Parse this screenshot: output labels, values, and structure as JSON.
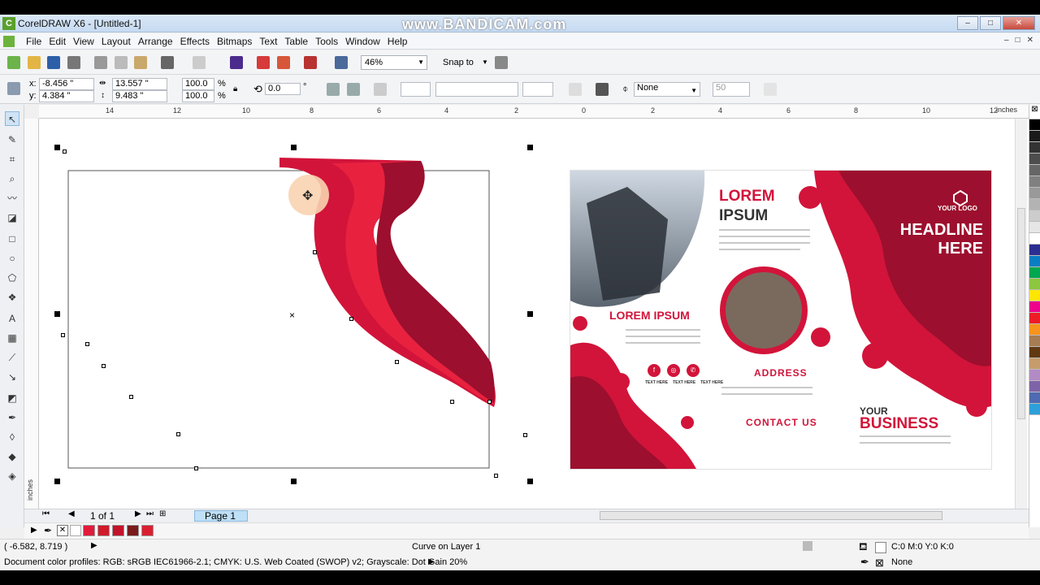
{
  "window": {
    "title": "CorelDRAW X6 - [Untitled-1]",
    "watermark": "www.BANDICAM.com",
    "minimize": "–",
    "restore": "□",
    "close": "✕"
  },
  "menu": {
    "items": [
      "File",
      "Edit",
      "View",
      "Layout",
      "Arrange",
      "Effects",
      "Bitmaps",
      "Text",
      "Table",
      "Tools",
      "Window",
      "Help"
    ],
    "right": [
      "–",
      "□",
      "✕"
    ]
  },
  "toolbar": {
    "zoom": "46%",
    "snap": "Snap to"
  },
  "property_bar": {
    "x_label": "x:",
    "x": "-8.456 \"",
    "y_label": "y:",
    "y": "4.384 \"",
    "w": "13.557 \"",
    "h": "9.483 \"",
    "scale_w": "100.0",
    "scale_h": "100.0",
    "pct": "%",
    "rotation": "0.0",
    "deg": "°",
    "outline": "None",
    "outline_val": "50"
  },
  "ruler": {
    "top_ticks": [
      "14",
      "12",
      "10",
      "8",
      "6",
      "4",
      "2",
      "0",
      "2",
      "4",
      "6",
      "8",
      "10",
      "12"
    ],
    "unit": "inches",
    "left_unit": "inches"
  },
  "brochure": {
    "your_logo": "YOUR LOGO",
    "headline": "HEADLINE HERE",
    "lorem_big_1": "LOREM",
    "lorem_big_2": "IPSUM",
    "lorem_small": "LOREM IPSUM",
    "address": "ADDRESS",
    "contact": "CONTACT US",
    "your": "YOUR",
    "business": "BUSINESS",
    "social_labels": [
      "TEXT HERE",
      "TEXT HERE",
      "TEXT HERE"
    ]
  },
  "pages": {
    "count": "1 of 1",
    "tab": "Page 1"
  },
  "status": {
    "cursor": "( -6.582, 8.719 )",
    "object": "Curve on Layer 1",
    "fill": "C:0 M:0 Y:0 K:0",
    "outline": "None",
    "profiles": "Document color profiles: RGB: sRGB IEC61966-2.1; CMYK: U.S. Web Coated (SWOP) v2; Grayscale: Dot Gain 20%"
  },
  "colors": {
    "accent": "#d2143a",
    "dark_red": "#9c0f2e",
    "mid_red": "#e8213f",
    "selection": "#000000"
  },
  "doc_palette": [
    "#e21b3c",
    "#d11a2a",
    "#c4142b",
    "#7a1c1c",
    "#dc1f2f"
  ],
  "color_palette": [
    "#000000",
    "#1a1a1a",
    "#333333",
    "#4d4d4d",
    "#666666",
    "#808080",
    "#999999",
    "#b3b3b3",
    "#cccccc",
    "#e6e6e6",
    "#ffffff",
    "#2b2f8f",
    "#0a7ec2",
    "#00a650",
    "#8dc63f",
    "#ffe600",
    "#ec008c",
    "#ed1c24",
    "#f7941d",
    "#a67c52",
    "#603913",
    "#c69c6d",
    "#b38bc4",
    "#7f63a8",
    "#4f6ab0",
    "#2e9fd8"
  ]
}
